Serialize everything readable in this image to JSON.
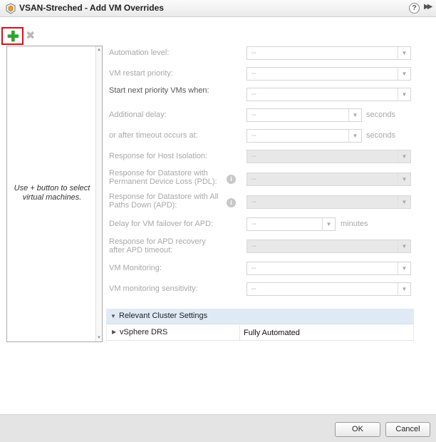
{
  "window": {
    "title": "VSAN-Streched - Add VM Overrides",
    "help_label": "?",
    "expand_label": "▶▶"
  },
  "toolbar": {
    "add_icon": "plus-icon",
    "add_label": "✚",
    "remove_icon": "close-icon",
    "remove_label": "✖",
    "highlight_color": "#d0121b",
    "add_color": "#2fa52f"
  },
  "vm_list": {
    "hint": "Use + button to select virtual machines."
  },
  "form": {
    "automation_level": {
      "label": "Automation level:",
      "value": "--"
    },
    "vm_restart_priority": {
      "label": "VM restart priority:",
      "value": "--"
    },
    "start_next": {
      "label": "Start next priority VMs when:",
      "value": "--"
    },
    "additional_delay": {
      "label": "Additional delay:",
      "value": "--",
      "unit": "seconds"
    },
    "after_timeout": {
      "label": "or after timeout occurs at:",
      "value": "--",
      "unit": "seconds"
    },
    "host_isolation": {
      "label": "Response for Host Isolation:",
      "value": "--"
    },
    "pdl": {
      "label": "Response for Datastore with Permanent Device Loss (PDL):",
      "value": "--"
    },
    "apd": {
      "label": "Response for Datastore with All Paths Down (APD):",
      "value": "--"
    },
    "apd_delay": {
      "label": "Delay for VM failover for APD:",
      "value": "--",
      "unit": "minutes"
    },
    "apd_recovery": {
      "label": "Response for APD recovery after APD timeout:",
      "value": "--"
    },
    "vm_monitoring": {
      "label": "VM Monitoring:",
      "value": "--"
    },
    "vm_monitoring_sensitivity": {
      "label": "VM monitoring sensitivity:",
      "value": "--"
    }
  },
  "cluster_settings": {
    "header": "Relevant Cluster Settings",
    "rows": [
      {
        "name": "vSphere DRS",
        "value": "Fully Automated"
      }
    ]
  },
  "footer": {
    "ok_label": "OK",
    "cancel_label": "Cancel"
  }
}
